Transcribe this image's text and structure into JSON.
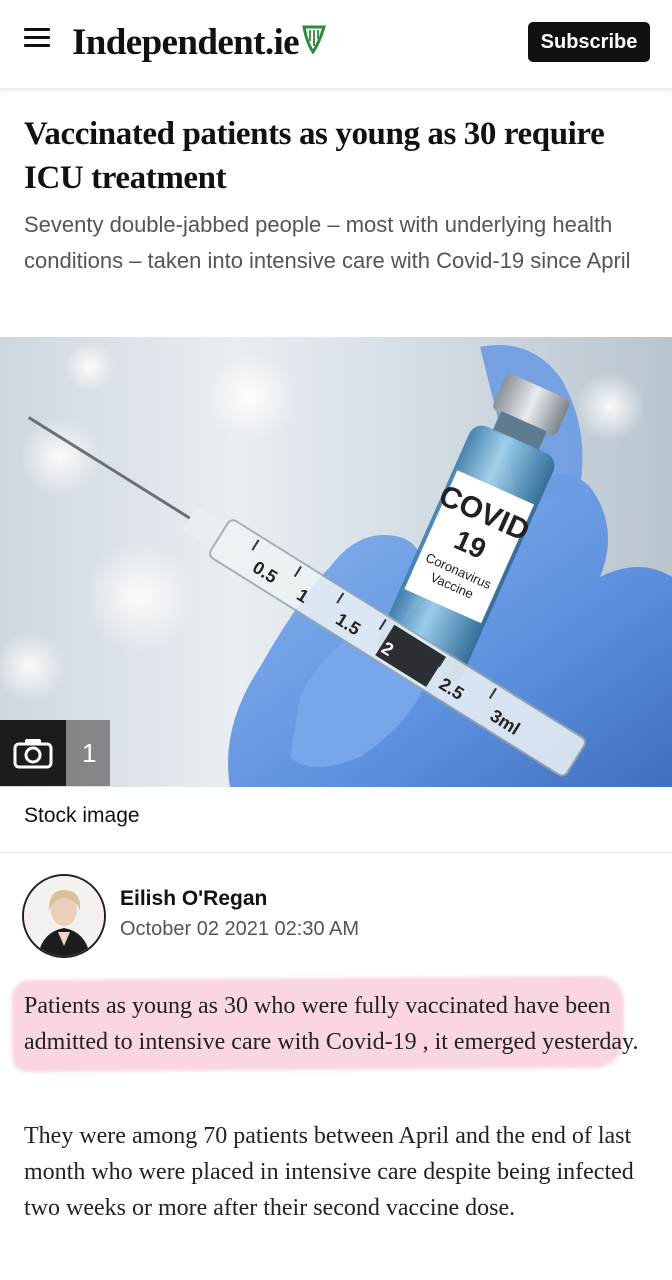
{
  "header": {
    "brand": "Independent.ie",
    "subscribe_label": "Subscribe",
    "menu_icon": "hamburger-menu-icon",
    "logo_icon": "harp-icon"
  },
  "article": {
    "headline": "Vaccinated patients as young as 30 require ICU treatment",
    "standfirst": "Seventy double-jabbed people – most with underlying health conditions – taken into intensive care with Covid-19 since April",
    "image": {
      "vial_label_line1": "COVID",
      "vial_label_line2": "19",
      "vial_label_line3": "Coronavirus",
      "vial_label_line4": "Vaccine",
      "syringe_marks": [
        "0.5",
        "1",
        "1.5",
        "2",
        "2.5",
        "3ml"
      ],
      "gallery_count": "1",
      "caption": "Stock image"
    },
    "author": {
      "name": "Eilish O'Regan",
      "date": "October 02 2021 02:30 AM"
    },
    "paragraphs": [
      "Patients as young as 30 who were fully vaccinated have been admitted to intensive care with Covid-19 , it emerged yesterday.",
      "They were among 70 patients between April and the end of last month who were placed in intensive care despite being infected two weeks or more after their second vaccine dose."
    ]
  },
  "colors": {
    "highlight": "#ee6e8c",
    "subscribe_bg": "#111111",
    "glove": "#6f9fe6"
  }
}
